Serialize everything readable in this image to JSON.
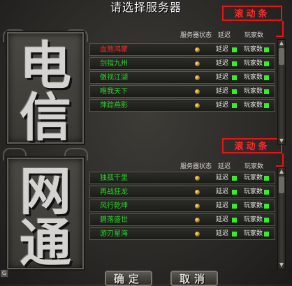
{
  "window": {
    "title": "请选择服务器"
  },
  "annotations": {
    "scrollbar_label_1": "滚动条",
    "scrollbar_label_2": "滚动条"
  },
  "telecom": {
    "big_label_chars": [
      "电",
      "信"
    ],
    "headers": {
      "status": "服务器状态",
      "latency": "延迟",
      "players": "玩家数"
    },
    "servers": [
      {
        "name": "血煞鸿蒙",
        "status": "online",
        "latency": "延迟",
        "players": "玩家数",
        "selected": true
      },
      {
        "name": "剑指九州",
        "status": "online",
        "latency": "延迟",
        "players": "玩家数",
        "selected": false
      },
      {
        "name": "傲视江湖",
        "status": "online",
        "latency": "延迟",
        "players": "玩家数",
        "selected": false
      },
      {
        "name": "唯我天下",
        "status": "online",
        "latency": "延迟",
        "players": "玩家数",
        "selected": false
      },
      {
        "name": "萍踪燕影",
        "status": "online",
        "latency": "延迟",
        "players": "玩家数",
        "selected": false
      }
    ]
  },
  "netcom": {
    "big_label_chars": [
      "网",
      "通"
    ],
    "headers": {
      "status": "服务器状态",
      "latency": "延迟",
      "players": "玩家数"
    },
    "servers": [
      {
        "name": "独孤千里",
        "status": "online",
        "latency": "延迟",
        "players": "玩家数",
        "selected": false
      },
      {
        "name": "再战狂龙",
        "status": "online",
        "latency": "延迟",
        "players": "玩家数",
        "selected": false
      },
      {
        "name": "风行乾坤",
        "status": "online",
        "latency": "延迟",
        "players": "玩家数",
        "selected": false
      },
      {
        "name": "碧落盛世",
        "status": "online",
        "latency": "延迟",
        "players": "玩家数",
        "selected": false
      },
      {
        "name": "游刃星海",
        "status": "online",
        "latency": "延迟",
        "players": "玩家数",
        "selected": false
      }
    ]
  },
  "footer": {
    "ok_label": "确定",
    "cancel_label": "取消",
    "corner_label": "G"
  },
  "colors": {
    "name_green": "#2fd02f",
    "selected_red": "#ff2a2a",
    "indicator_green": "#3bea2c",
    "annotation_red": "#e5141a"
  }
}
